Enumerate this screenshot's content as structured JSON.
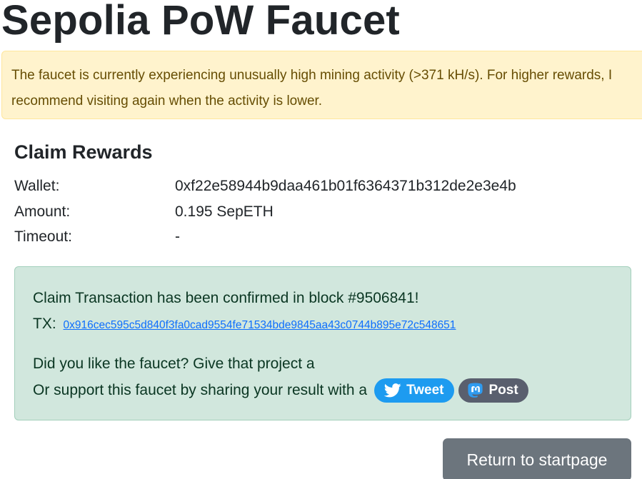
{
  "page": {
    "title": "Sepolia PoW Faucet"
  },
  "warning": {
    "text": "The faucet is currently experiencing unusually high mining activity (>371 kH/s). For higher rewards, I recommend visiting again when the activity is lower."
  },
  "claim": {
    "heading": "Claim Rewards",
    "wallet_label": "Wallet:",
    "wallet_value": "0xf22e58944b9daa461b01f6364371b312de2e3e4b",
    "amount_label": "Amount:",
    "amount_value": "0.195 SepETH",
    "timeout_label": "Timeout:",
    "timeout_value": "-"
  },
  "result": {
    "confirm_text": "Claim Transaction has been confirmed in block #9506841!",
    "tx_label": "TX:",
    "tx_hash": "0x916cec595c5d840f3fa0cad9554fe71534bde9845aa43c0744b895e72c548651",
    "like_text": "Did you like the faucet? Give that project a",
    "support_text": "Or support this faucet by sharing your result with a",
    "tweet_label": "Tweet",
    "post_label": "Post"
  },
  "actions": {
    "return_label": "Return to startpage"
  },
  "icons": {
    "tweet": "twitter-bird-icon",
    "post": "mastodon-icon"
  },
  "colors": {
    "warning_bg": "#fff3cd",
    "warning_text": "#664d03",
    "success_bg": "#d1e7dd",
    "success_text": "#0a3622",
    "link": "#0d6efd",
    "tweet_bg": "#1d9bf0",
    "post_bg": "#595f6e",
    "return_bg": "#6c757d"
  }
}
